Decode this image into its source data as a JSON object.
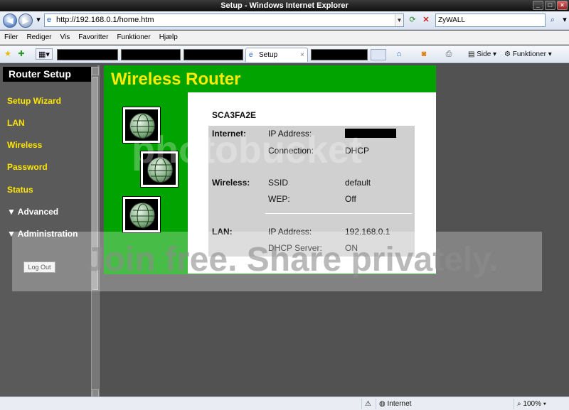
{
  "window": {
    "title": "Setup - Windows Internet Explorer"
  },
  "address_bar": {
    "url": "http://192.168.0.1/home.htm",
    "search_placeholder": "ZyWALL"
  },
  "menu": [
    "Filer",
    "Rediger",
    "Vis",
    "Favoritter",
    "Funktioner",
    "Hjælp"
  ],
  "tabs": {
    "active_label": "Setup"
  },
  "command_bar": {
    "page_label": "Side",
    "tools_label": "Funktioner"
  },
  "sidebar": {
    "title": "Router Setup",
    "items": [
      {
        "label": "Setup Wizard"
      },
      {
        "label": "LAN"
      },
      {
        "label": "Wireless"
      },
      {
        "label": "Password"
      },
      {
        "label": "Status"
      },
      {
        "label": "Advanced"
      },
      {
        "label": "Administration"
      }
    ],
    "logout_label": "Log Out"
  },
  "main": {
    "title": "Wireless Router",
    "device_name": "SCA3FA2E",
    "internet": {
      "label": "Internet:",
      "ip_label": "IP Address:",
      "conn_label": "Connection:",
      "conn_value": "DHCP"
    },
    "wireless": {
      "label": "Wireless:",
      "ssid_label": "SSID",
      "ssid_value": "default",
      "wep_label": "WEP:",
      "wep_value": "Off"
    },
    "lan": {
      "label": "LAN:",
      "ip_label": "IP Address:",
      "ip_value": "192.168.0.1",
      "dhcp_label": "DHCP Server:",
      "dhcp_value": "ON"
    }
  },
  "watermark": {
    "brand": "photobucket",
    "tagline": "Join free. Share privately."
  },
  "status": {
    "zone": "Internet",
    "zoom": "100%"
  }
}
